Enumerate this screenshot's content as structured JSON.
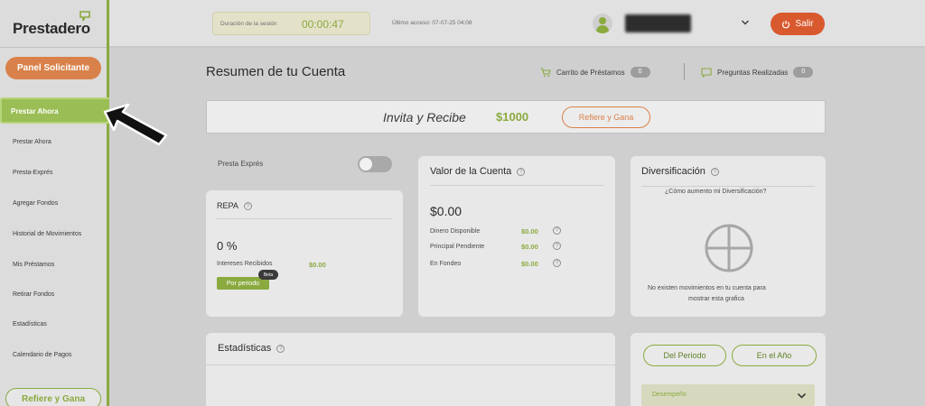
{
  "sidebar": {
    "logo": "Prestadero",
    "panel_button": "Panel Solicitante",
    "active_item": "Prestar Ahora",
    "items": [
      "Prestar Ahora",
      "Presta-Exprés",
      "Agregar Fondos",
      "Historial de Movimientos",
      "Mis Préstamos",
      "Retirar Fondos",
      "Estadísticas",
      "Calendario de Pagos"
    ],
    "refer_button": "Refiere y Gana"
  },
  "header": {
    "session_label": "Duración de la sesión",
    "session_time": "00:00:47",
    "last_access": "Último acceso: 07-07-25 04:08",
    "logout_button": "Salir"
  },
  "main": {
    "title": "Resumen de tu Cuenta",
    "cart_label": "Carrito de Préstamos",
    "cart_count": "0",
    "questions_label": "Preguntas Realizadas",
    "questions_count": "0",
    "invite": {
      "text": "Invita y Recibe",
      "amount": "$1000",
      "button": "Refiere y Gana"
    },
    "presta_expres_label": "Presta Exprés",
    "repa": {
      "title": "REPA",
      "percent": "0 %",
      "interest_label": "Intereses Recibidos",
      "interest_value": "$0.00",
      "period_button": "Por periodo",
      "beta": "Beta"
    },
    "account_value": {
      "title": "Valor de la Cuenta",
      "total": "$0.00",
      "rows": [
        {
          "label": "Dinero Disponible",
          "value": "$0.00"
        },
        {
          "label": "Principal Pendiente",
          "value": "$0.00"
        },
        {
          "label": "En Fondeo",
          "value": "$0.00"
        }
      ]
    },
    "diversification": {
      "title": "Diversificación",
      "question": "¿Cómo aumento mi Diversificación?",
      "empty_line1": "No existen movimientos en tu cuenta para",
      "empty_line2": "mostrar esta grafica"
    },
    "stats": {
      "title": "Estadísticas"
    },
    "period_panel": {
      "btn_period": "Del Periodo",
      "btn_year": "En el Año",
      "select_value": "Desempeño"
    }
  },
  "colors": {
    "brand_green": "#8aaa3f",
    "brand_orange": "#d9814a",
    "logout_red": "#d9592e"
  }
}
